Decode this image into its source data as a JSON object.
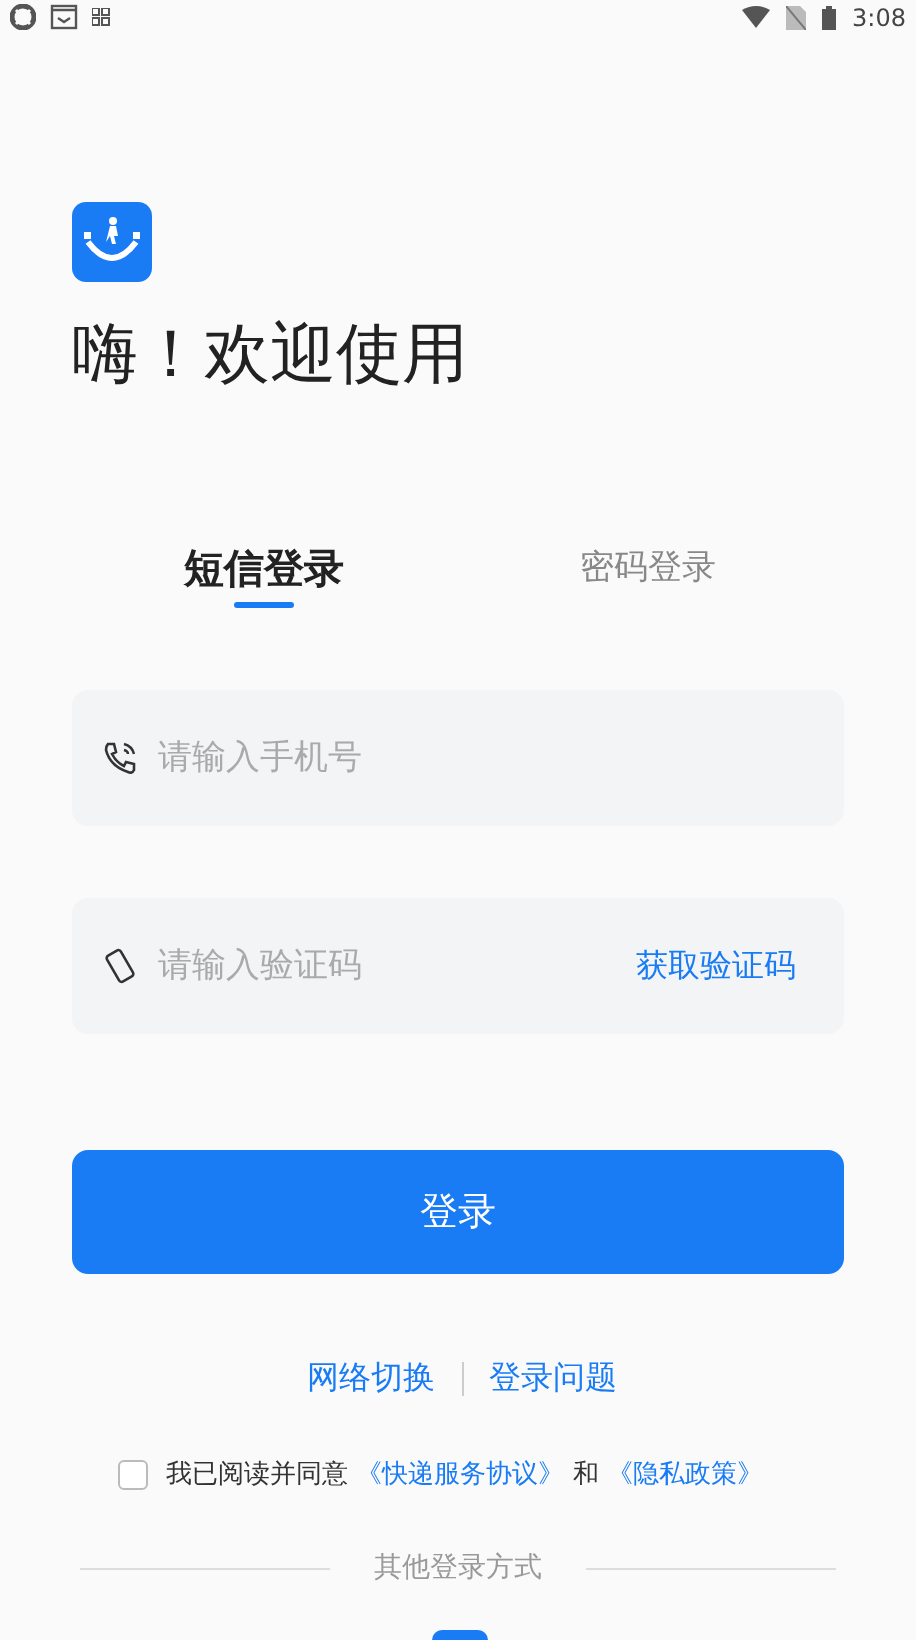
{
  "status_bar": {
    "time": "3:08"
  },
  "title": "嗨！欢迎使用",
  "tabs": [
    {
      "label": "短信登录",
      "selected": true
    },
    {
      "label": "密码登录",
      "selected": false
    }
  ],
  "phone_field": {
    "placeholder": "请输入手机号"
  },
  "code_field": {
    "placeholder": "请输入验证码",
    "action": "获取验证码"
  },
  "login_button": "登录",
  "links": [
    "网络切换",
    "登录问题"
  ],
  "agreement": {
    "checked": false,
    "prefix": "我已阅读并同意",
    "service_link": "《快递服务协议》",
    "joiner": "和",
    "privacy_link": "《隐私政策》"
  },
  "other_methods": "其他登录方式"
}
